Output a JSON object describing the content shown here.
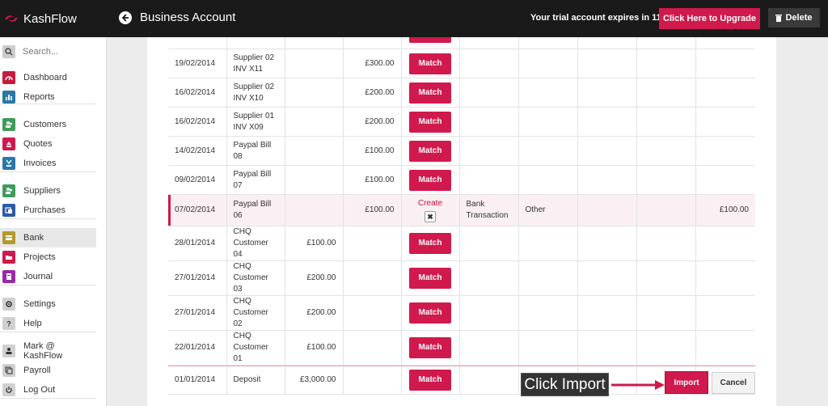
{
  "app": {
    "name": "KashFlow",
    "page_title": "Business Account",
    "trial_text": "Your trial account expires in 11 days",
    "upgrade_label": "Click Here to Upgrade",
    "delete_label": "Delete"
  },
  "colors": {
    "accent": "#d0194d",
    "topbar": "#1a1a1a"
  },
  "sidebar": {
    "search_placeholder": "Search...",
    "items": [
      {
        "label": "Dashboard",
        "icon": "gauge-icon",
        "color": "#c8193f"
      },
      {
        "label": "Reports",
        "icon": "chart-icon",
        "color": "#2a78a8"
      },
      {
        "label": "Customers",
        "icon": "people-icon",
        "color": "#3f9b5a"
      },
      {
        "label": "Quotes",
        "icon": "quote-icon",
        "color": "#d0194d"
      },
      {
        "label": "Invoices",
        "icon": "invoice-icon",
        "color": "#2a78a8"
      },
      {
        "label": "Suppliers",
        "icon": "people-icon",
        "color": "#3f9b5a"
      },
      {
        "label": "Purchases",
        "icon": "purchase-icon",
        "color": "#2a5aa8"
      },
      {
        "label": "Bank",
        "icon": "bank-icon",
        "color": "#b49a2a"
      },
      {
        "label": "Projects",
        "icon": "folder-icon",
        "color": "#d0194d"
      },
      {
        "label": "Journal",
        "icon": "journal-icon",
        "color": "#9a2aa8"
      },
      {
        "label": "Settings",
        "icon": "gear-icon",
        "color": "#999999"
      },
      {
        "label": "Help",
        "icon": "help-icon",
        "color": "#999999"
      },
      {
        "label": "Mark @ KashFlow",
        "icon": "user-icon",
        "color": "#999999"
      },
      {
        "label": "Payroll",
        "icon": "payroll-icon",
        "color": "#999999"
      },
      {
        "label": "Log Out",
        "icon": "power-icon",
        "color": "#999999"
      }
    ]
  },
  "table": {
    "match_label": "Match",
    "create_label": "Create",
    "rows": [
      {
        "date": "19/02/2014",
        "desc": "Supplier 02 INV X11",
        "money_in": "",
        "money_out": "£300.00",
        "action": "match"
      },
      {
        "date": "16/02/2014",
        "desc": "Supplier 02 INV X10",
        "money_in": "",
        "money_out": "£200.00",
        "action": "match"
      },
      {
        "date": "16/02/2014",
        "desc": "Supplier 01 INV X09",
        "money_in": "",
        "money_out": "£200.00",
        "action": "match"
      },
      {
        "date": "14/02/2014",
        "desc": "Paypal Bill 08",
        "money_in": "",
        "money_out": "£100.00",
        "action": "match"
      },
      {
        "date": "09/02/2014",
        "desc": "Paypal Bill 07",
        "money_in": "",
        "money_out": "£100.00",
        "action": "match"
      },
      {
        "date": "07/02/2014",
        "desc": "Paypal Bill 06",
        "money_in": "",
        "money_out": "£100.00",
        "action": "create",
        "type": "Bank Transaction",
        "category": "Other",
        "amount": "£100.00"
      },
      {
        "date": "28/01/2014",
        "desc": "CHQ Customer 04",
        "money_in": "£100.00",
        "money_out": "",
        "action": "match"
      },
      {
        "date": "27/01/2014",
        "desc": "CHQ Customer 03",
        "money_in": "£200.00",
        "money_out": "",
        "action": "match"
      },
      {
        "date": "27/01/2014",
        "desc": "CHQ Customer 02",
        "money_in": "£200.00",
        "money_out": "",
        "action": "match"
      },
      {
        "date": "22/01/2014",
        "desc": "CHQ Customer 01",
        "money_in": "£100.00",
        "money_out": "",
        "action": "match"
      },
      {
        "date": "01/01/2014",
        "desc": "Deposit",
        "money_in": "£3,000.00",
        "money_out": "",
        "action": "match"
      }
    ]
  },
  "footer": {
    "callout": "Click Import",
    "import_label": "Import",
    "cancel_label": "Cancel"
  }
}
